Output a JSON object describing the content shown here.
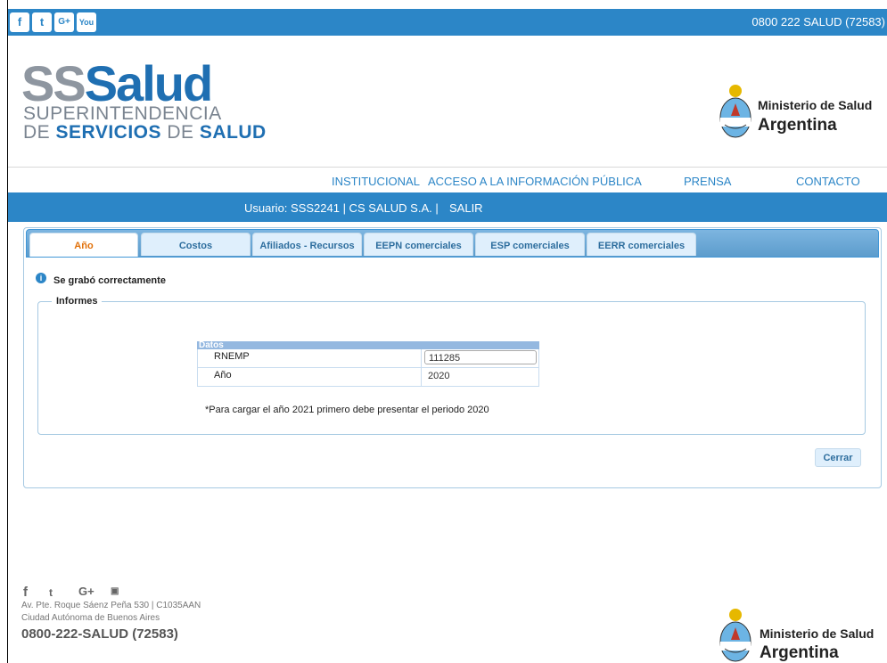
{
  "topbar": {
    "social": [
      "f",
      "t",
      "G+",
      "You"
    ],
    "phone": "0800 222 SALUD (72583)"
  },
  "logo": {
    "ss": "SS",
    "salud": "Salud",
    "line1": "SUPERINTENDENCIA",
    "line2_de": "DE",
    "line2_servicios": "SERVICIOS",
    "line2_de2": "DE",
    "line2_salud": "SALUD"
  },
  "ministry": {
    "name": "Ministerio de Salud",
    "country": "Argentina"
  },
  "nav": {
    "items": [
      "INSTITUCIONAL",
      "ACCESO A LA INFORMACIÓN PÚBLICA",
      "PRENSA",
      "CONTACTO"
    ]
  },
  "userbar": {
    "text": "Usuario: SSS2241 | CS SALUD S.A. |",
    "logout": "SALIR"
  },
  "tabs": [
    "Año",
    "Costos",
    "Afiliados - Recursos",
    "EEPN comerciales",
    "ESP comerciales",
    "EERR comerciales"
  ],
  "message": "Se grabó correctamente",
  "informes": {
    "legend": "Informes",
    "table_header": "Datos",
    "rows": [
      {
        "label": "RNEMP",
        "value": "111285"
      },
      {
        "label": "Año",
        "value": "2020"
      }
    ],
    "note": "*Para cargar el año 2021 primero debe presentar el periodo 2020"
  },
  "buttons": {
    "close": "Cerrar"
  },
  "footer": {
    "address1": "Av. Pte. Roque Sáenz Peña 530 | C1035AAN",
    "address2": "Ciudad Autónoma de Buenos Aires",
    "phone": "0800-222-SALUD (72583)",
    "ministry": "Ministerio de Salud",
    "country": "Argentina"
  },
  "colors": {
    "brand_blue": "#2c86c7",
    "tab_orange": "#e17009"
  }
}
